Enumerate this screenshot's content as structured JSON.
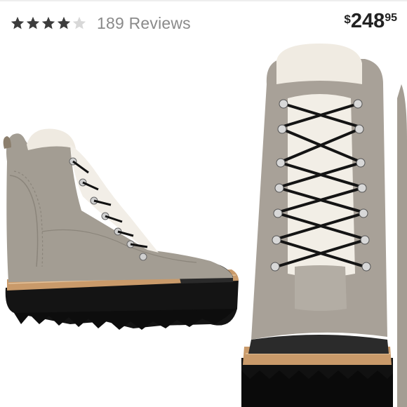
{
  "rating": {
    "value": 4.5,
    "max": 5,
    "reviews_label": "189 Reviews"
  },
  "price": {
    "currency": "$",
    "dollars": "248",
    "cents": "95"
  },
  "colors": {
    "star": "#3c3c3c",
    "star_empty": "#d8d8d8",
    "reviews_text": "#8a8a8a",
    "price_text": "#222222"
  },
  "image": {
    "subject": "hiking-boot-product-photo"
  }
}
